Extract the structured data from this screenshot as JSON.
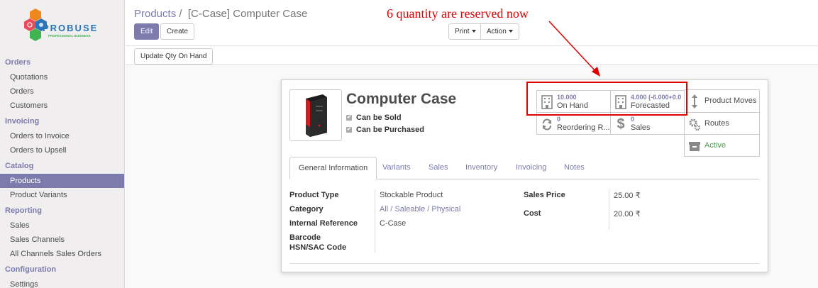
{
  "sidebar": {
    "logo": {
      "brand": "PROBUSE",
      "tagline": "PROFESSIONAL BUSINESS"
    },
    "sections": [
      {
        "label": "Orders",
        "items": [
          "Quotations",
          "Orders",
          "Customers"
        ]
      },
      {
        "label": "Invoicing",
        "items": [
          "Orders to Invoice",
          "Orders to Upsell"
        ]
      },
      {
        "label": "Catalog",
        "items": [
          "Products",
          "Product Variants"
        ]
      },
      {
        "label": "Reporting",
        "items": [
          "Sales",
          "Sales Channels",
          "All Channels Sales Orders"
        ]
      },
      {
        "label": "Configuration",
        "items": [
          "Settings"
        ]
      }
    ],
    "active_item": "Products"
  },
  "header": {
    "breadcrumb_parent": "Products",
    "breadcrumb_sep": "/",
    "breadcrumb_current": "[C-Case] Computer Case",
    "edit_label": "Edit",
    "create_label": "Create",
    "print_label": "Print",
    "action_label": "Action",
    "update_qty_label": "Update Qty On Hand"
  },
  "product": {
    "name": "Computer Case",
    "can_be_sold": "Can be Sold",
    "can_be_purchased": "Can be Purchased"
  },
  "smart_buttons": {
    "on_hand": {
      "value": "10.000",
      "label": "On Hand"
    },
    "forecasted": {
      "value": "4.000 (-6.000+0.0",
      "label": "Forecasted"
    },
    "product_moves": {
      "label": "Product Moves"
    },
    "reordering": {
      "value": "0",
      "label": "Reordering R..."
    },
    "sales": {
      "value": "0",
      "label": "Sales"
    },
    "routes": {
      "label": "Routes"
    },
    "active": {
      "label": "Active"
    }
  },
  "tabs": [
    "General Information",
    "Variants",
    "Sales",
    "Inventory",
    "Invoicing",
    "Notes"
  ],
  "general_info": {
    "product_type_label": "Product Type",
    "product_type": "Stockable Product",
    "category_label": "Category",
    "category": "All / Saleable / Physical",
    "internal_ref_label": "Internal Reference",
    "internal_ref": "C-Case",
    "barcode_label": "Barcode",
    "hsn_label": "HSN/SAC Code",
    "sales_price_label": "Sales Price",
    "sales_price": "25.00 ₹",
    "cost_label": "Cost",
    "cost": "20.00 ₹"
  },
  "annotation": {
    "text": "6 quantity are reserved now"
  },
  "colors": {
    "accent": "#7c7bad",
    "annotation": "#e00000",
    "active_green": "#4b9c4b"
  }
}
